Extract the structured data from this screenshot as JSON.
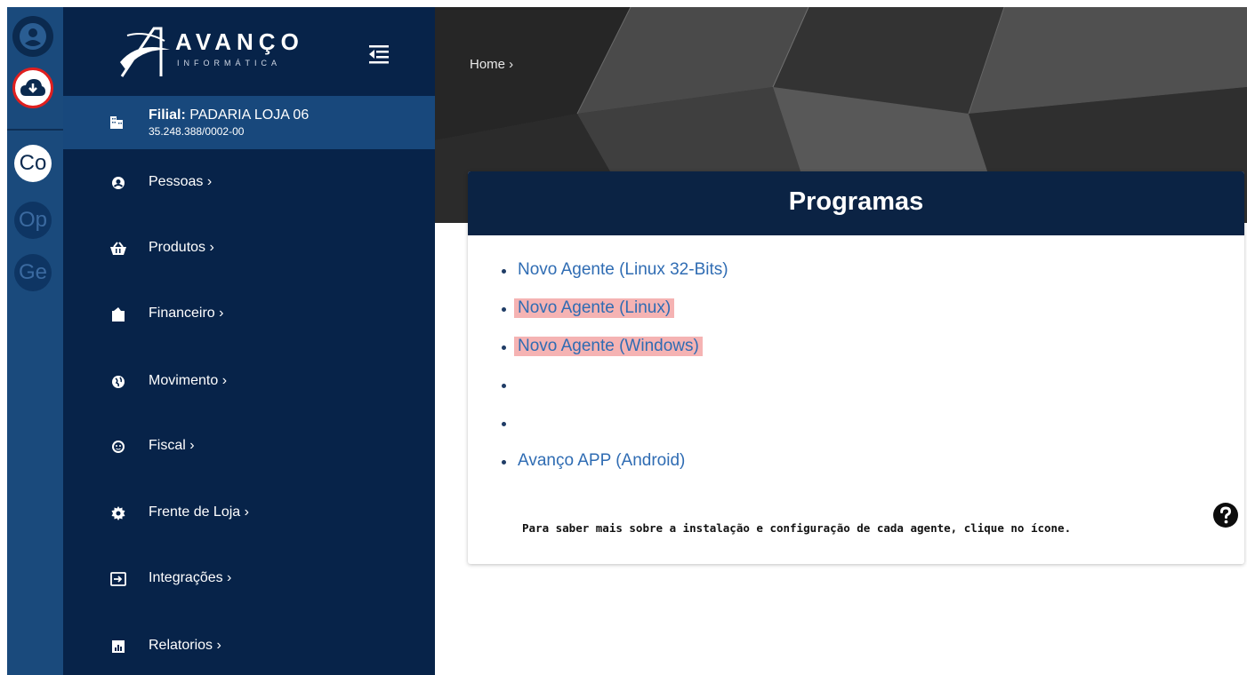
{
  "brand": {
    "name": "AVANÇO",
    "sub": "INFORMÁTICA"
  },
  "rail": {
    "letters": [
      "Co",
      "Op",
      "Ge"
    ]
  },
  "filial": {
    "label": "Filial:",
    "name": "PADARIA LOJA 06",
    "cnpj": "35.248.388/0002-00"
  },
  "menu": [
    {
      "label": "Pessoas ›",
      "icon": "user-circle-icon"
    },
    {
      "label": "Produtos ›",
      "icon": "basket-icon"
    },
    {
      "label": "Financeiro ›",
      "icon": "wallet-icon"
    },
    {
      "label": "Movimento ›",
      "icon": "globe-icon"
    },
    {
      "label": "Fiscal ›",
      "icon": "mask-icon"
    },
    {
      "label": "Frente de Loja ›",
      "icon": "gear-icon"
    },
    {
      "label": "Integrações ›",
      "icon": "sign-in-icon"
    },
    {
      "label": "Relatorios ›",
      "icon": "chart-icon"
    }
  ],
  "breadcrumb": "Home ›",
  "card": {
    "title": "Programas",
    "items": [
      {
        "label": "Novo Agente (Linux 32-Bits)",
        "highlight": false
      },
      {
        "label": "Novo Agente (Linux)",
        "highlight": true
      },
      {
        "label": "Novo Agente (Windows)",
        "highlight": true
      },
      {
        "label": "",
        "highlight": false
      },
      {
        "label": "",
        "highlight": false
      },
      {
        "label": "Avanço APP (Android)",
        "highlight": false
      }
    ],
    "help_text": "Para saber mais sobre a instalação e configuração de cada agente, clique no ícone."
  },
  "colors": {
    "sidebar": "#072349",
    "rail": "#1a4a7c",
    "link": "#2f6cb3",
    "highlight": "#f5b3b3",
    "card_header": "#0b2344"
  }
}
